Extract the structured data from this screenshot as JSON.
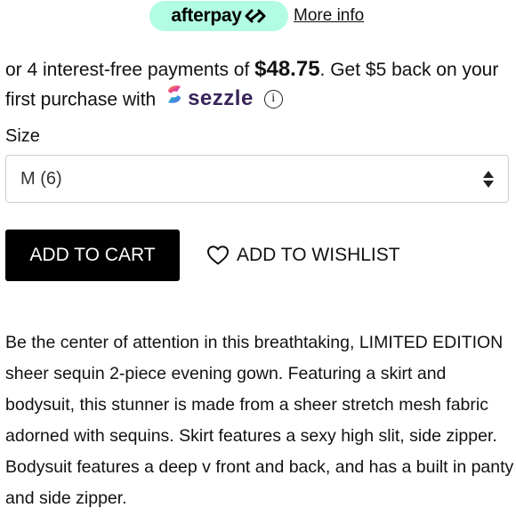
{
  "afterpay": {
    "brand": "afterpay",
    "more_info_label": "More info",
    "brand_color": "#b2fce4"
  },
  "payment": {
    "prefix": "or 4 interest-free payments of ",
    "amount": "$48.75",
    "suffix": ". Get $5 back on your first purchase with",
    "sezzle_brand": "sezzle",
    "info_icon": "i"
  },
  "size": {
    "label": "Size",
    "selected": "M (6)"
  },
  "actions": {
    "add_to_cart": "ADD TO CART",
    "add_to_wishlist": "ADD TO WISHLIST"
  },
  "description": "Be the center of attention in this breathtaking, LIMITED EDITION sheer sequin 2-piece evening gown. Featuring a skirt and bodysuit, this stunner is made from a sheer stretch mesh fabric adorned with sequins. Skirt features a sexy high slit, side zipper. Bodysuit features a deep v front and back, and has a built in panty and side zipper.",
  "icons": {
    "afterpay": "afterpay-arrows-icon",
    "sezzle": "sezzle-logo-icon",
    "info": "info-icon",
    "select": "select-arrows-icon",
    "wishlist": "heart-icon"
  }
}
